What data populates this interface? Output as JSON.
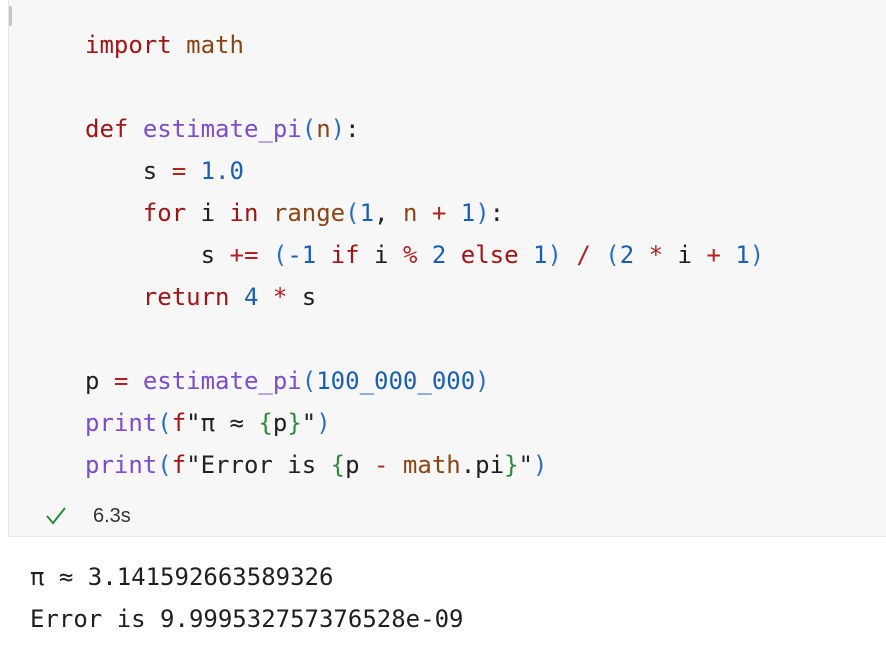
{
  "cell": {
    "code_lines": [
      [
        {
          "t": "import",
          "c": "kw"
        },
        {
          "t": " "
        },
        {
          "t": "math",
          "c": "mod"
        }
      ],
      [],
      [
        {
          "t": "def",
          "c": "kw"
        },
        {
          "t": " "
        },
        {
          "t": "estimate_pi",
          "c": "fn"
        },
        {
          "t": "(",
          "c": "paren"
        },
        {
          "t": "n",
          "c": "mod"
        },
        {
          "t": ")",
          "c": "paren"
        },
        {
          "t": ":"
        }
      ],
      [
        {
          "t": "    s "
        },
        {
          "t": "=",
          "c": "op"
        },
        {
          "t": " "
        },
        {
          "t": "1.0",
          "c": "num"
        }
      ],
      [
        {
          "t": "    "
        },
        {
          "t": "for",
          "c": "kw"
        },
        {
          "t": " i "
        },
        {
          "t": "in",
          "c": "kw"
        },
        {
          "t": " "
        },
        {
          "t": "range",
          "c": "mod"
        },
        {
          "t": "(",
          "c": "paren"
        },
        {
          "t": "1",
          "c": "num"
        },
        {
          "t": ", "
        },
        {
          "t": "n",
          "c": "mod"
        },
        {
          "t": " "
        },
        {
          "t": "+",
          "c": "op"
        },
        {
          "t": " "
        },
        {
          "t": "1",
          "c": "num"
        },
        {
          "t": ")",
          "c": "paren"
        },
        {
          "t": ":"
        }
      ],
      [
        {
          "t": "        s "
        },
        {
          "t": "+=",
          "c": "op"
        },
        {
          "t": " "
        },
        {
          "t": "(",
          "c": "paren"
        },
        {
          "t": "-1",
          "c": "num"
        },
        {
          "t": " "
        },
        {
          "t": "if",
          "c": "kw"
        },
        {
          "t": " i "
        },
        {
          "t": "%",
          "c": "op"
        },
        {
          "t": " "
        },
        {
          "t": "2",
          "c": "num"
        },
        {
          "t": " "
        },
        {
          "t": "else",
          "c": "kw"
        },
        {
          "t": " "
        },
        {
          "t": "1",
          "c": "num"
        },
        {
          "t": ")",
          "c": "paren"
        },
        {
          "t": " "
        },
        {
          "t": "/",
          "c": "op"
        },
        {
          "t": " "
        },
        {
          "t": "(",
          "c": "paren"
        },
        {
          "t": "2",
          "c": "num"
        },
        {
          "t": " "
        },
        {
          "t": "*",
          "c": "op"
        },
        {
          "t": " i "
        },
        {
          "t": "+",
          "c": "op"
        },
        {
          "t": " "
        },
        {
          "t": "1",
          "c": "num"
        },
        {
          "t": ")",
          "c": "paren"
        }
      ],
      [
        {
          "t": "    "
        },
        {
          "t": "return",
          "c": "kw"
        },
        {
          "t": " "
        },
        {
          "t": "4",
          "c": "num"
        },
        {
          "t": " "
        },
        {
          "t": "*",
          "c": "op"
        },
        {
          "t": " s"
        }
      ],
      [],
      [
        {
          "t": "p "
        },
        {
          "t": "=",
          "c": "op"
        },
        {
          "t": " "
        },
        {
          "t": "estimate_pi",
          "c": "fn"
        },
        {
          "t": "(",
          "c": "paren"
        },
        {
          "t": "100_000_000",
          "c": "num"
        },
        {
          "t": ")",
          "c": "paren"
        }
      ],
      [
        {
          "t": "print",
          "c": "builtin"
        },
        {
          "t": "(",
          "c": "paren"
        },
        {
          "t": "f",
          "c": "prefix"
        },
        {
          "t": "\"π ≈ ",
          "c": "str"
        },
        {
          "t": "{",
          "c": "brace"
        },
        {
          "t": "p"
        },
        {
          "t": "}",
          "c": "brace"
        },
        {
          "t": "\"",
          "c": "str"
        },
        {
          "t": ")",
          "c": "paren"
        }
      ],
      [
        {
          "t": "print",
          "c": "builtin"
        },
        {
          "t": "(",
          "c": "paren"
        },
        {
          "t": "f",
          "c": "prefix"
        },
        {
          "t": "\"Error is ",
          "c": "str"
        },
        {
          "t": "{",
          "c": "brace"
        },
        {
          "t": "p "
        },
        {
          "t": "-",
          "c": "op"
        },
        {
          "t": " "
        },
        {
          "t": "math",
          "c": "mod"
        },
        {
          "t": ".pi"
        },
        {
          "t": "}",
          "c": "brace"
        },
        {
          "t": "\"",
          "c": "str"
        },
        {
          "t": ")",
          "c": "paren"
        }
      ]
    ],
    "status": {
      "icon": "check-icon",
      "execution_time": "6.3s",
      "success_color": "#2e8b3c"
    }
  },
  "output": {
    "lines": [
      "π ≈ 3.141592663589326",
      "Error is 9.999532757376528e-09"
    ]
  }
}
